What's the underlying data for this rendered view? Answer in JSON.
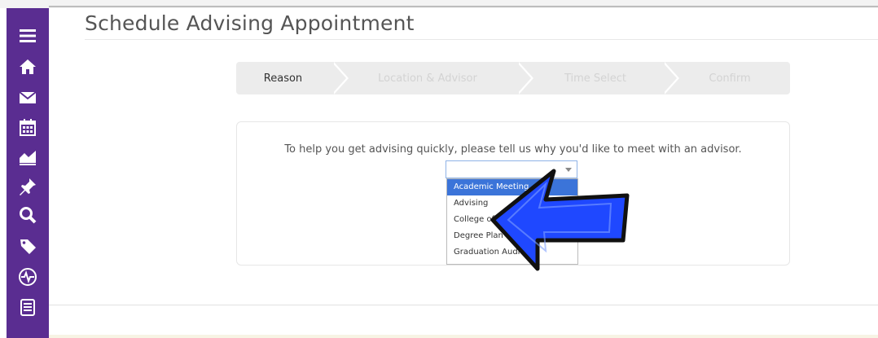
{
  "page": {
    "title": "Schedule Advising Appointment"
  },
  "sidebar": {
    "icons": [
      "menu-icon",
      "home-icon",
      "mail-icon",
      "calendar-icon",
      "chart-icon",
      "pin-icon",
      "search-icon",
      "tag-icon",
      "heartbeat-icon",
      "notes-icon"
    ]
  },
  "steps": [
    {
      "label": "Reason",
      "active": true
    },
    {
      "label": "Location & Advisor",
      "active": false
    },
    {
      "label": "Time Select",
      "active": false
    },
    {
      "label": "Confirm",
      "active": false
    }
  ],
  "main": {
    "prompt": "To help you get advising quickly, please tell us why you'd like to meet with an advisor.",
    "select_value": "",
    "options": [
      "Academic Meeting",
      "Advising",
      "College of B",
      "Degree Plan",
      "Graduation Audit"
    ],
    "selected_option_index": 0
  },
  "colors": {
    "sidebar": "#5a2d91",
    "accent": "#3b74d9",
    "arrow": "#1f48ff"
  }
}
